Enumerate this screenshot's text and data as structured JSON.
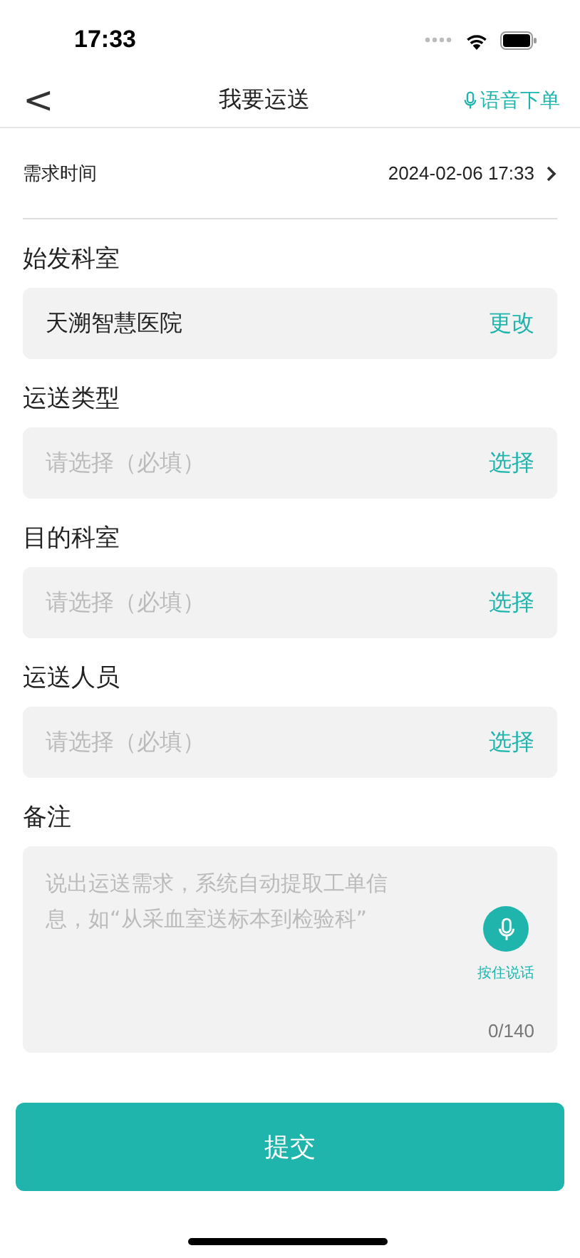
{
  "status_bar": {
    "time": "17:33"
  },
  "nav": {
    "back": "<",
    "title": "我要运送",
    "voice_action": "语音下单"
  },
  "time_row": {
    "label": "需求时间",
    "value": "2024-02-06 17:33"
  },
  "fields": [
    {
      "label": "始发科室",
      "value": "天溯智慧医院",
      "action": "更改"
    },
    {
      "label": "运送类型",
      "placeholder": "请选择（必填）",
      "action": "选择"
    },
    {
      "label": "目的科室",
      "placeholder": "请选择（必填）",
      "action": "选择"
    },
    {
      "label": "运送人员",
      "placeholder": "请选择（必填）",
      "action": "选择"
    }
  ],
  "remarks": {
    "label": "备注",
    "placeholder": "说出运送需求，系统自动提取工单信息，如“从采血室送标本到检验科”",
    "hold_to_talk": "按住说话",
    "counter": "0/140"
  },
  "submit": "提交"
}
